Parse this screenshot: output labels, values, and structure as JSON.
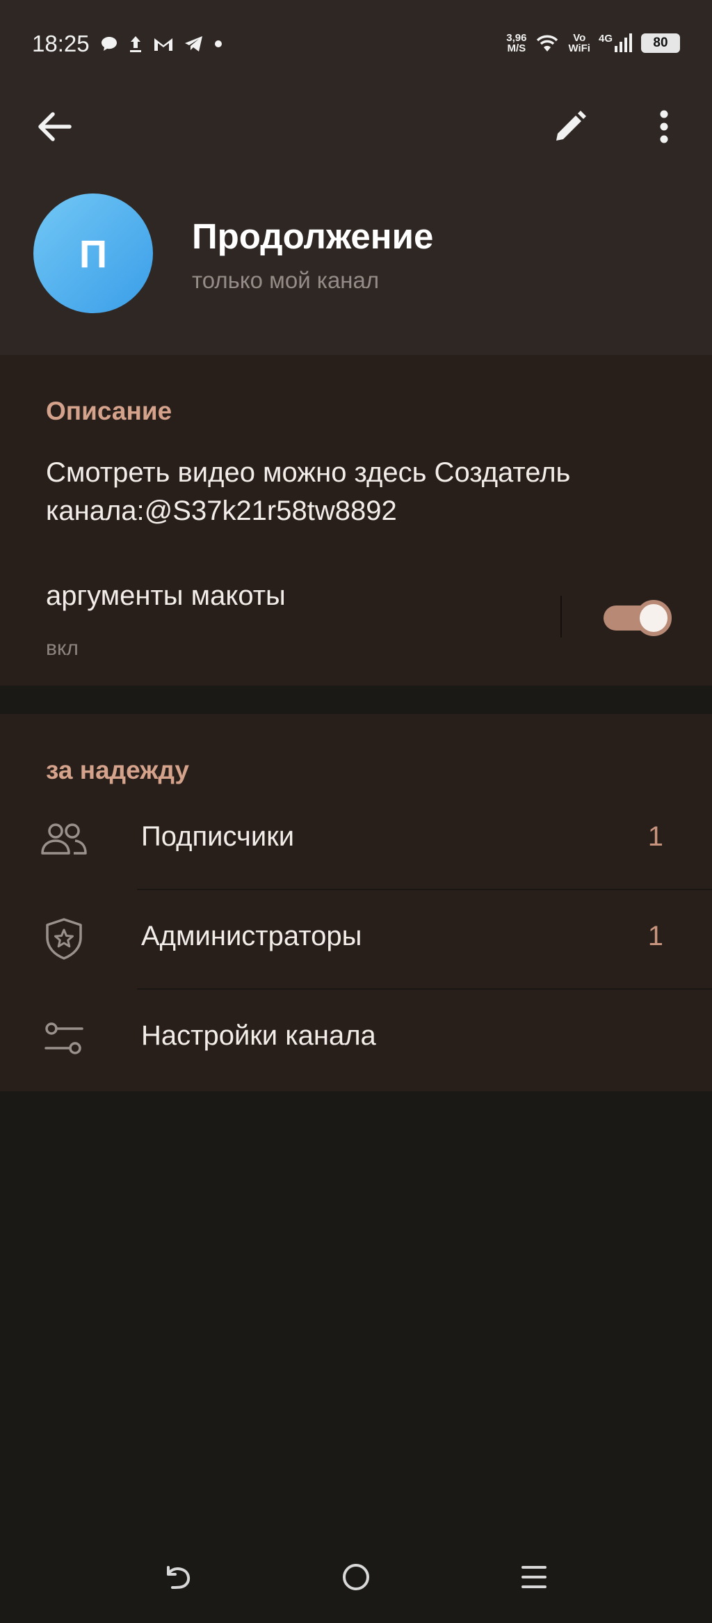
{
  "status_bar": {
    "time": "18:25",
    "speed_value": "3,96",
    "speed_unit": "M/S",
    "vo_label": "Vo",
    "wifi_label": "WiFi",
    "network_label": "4G",
    "battery": "80",
    "left_icons": [
      "chat-bubble-icon",
      "upload-icon",
      "gmail-icon",
      "telegram-icon",
      "dot-icon"
    ]
  },
  "toolbar": {
    "back_icon": "arrow-back-icon",
    "edit_icon": "pencil-icon",
    "more_icon": "more-vertical-icon"
  },
  "channel": {
    "avatar_letter": "П",
    "title": "Продолжение",
    "subtitle": "только мой канал"
  },
  "description_section": {
    "title": "Описание",
    "text": "Смотреть видео можно здесь Создатель канала:@S37k21r58tw8892",
    "toggle_label": "аргументы макоты",
    "toggle_state_text": "вкл",
    "toggle_on": true
  },
  "hope_section": {
    "title": "за надежду",
    "items": [
      {
        "label": "Подписчики",
        "count": "1",
        "icon": "people-icon"
      },
      {
        "label": "Администраторы",
        "count": "1",
        "icon": "shield-star-icon"
      },
      {
        "label": "Настройки канала",
        "count": "",
        "icon": "sliders-icon"
      }
    ]
  },
  "colors": {
    "header_bg": "#2f2723",
    "card_bg": "#281f1b",
    "page_bg": "#1a1915",
    "accent": "#d5a28b",
    "switch_track": "#b88a76"
  },
  "nav_bar": {
    "back": "nav-back-icon",
    "home": "nav-home-icon",
    "recents": "nav-recents-icon"
  }
}
